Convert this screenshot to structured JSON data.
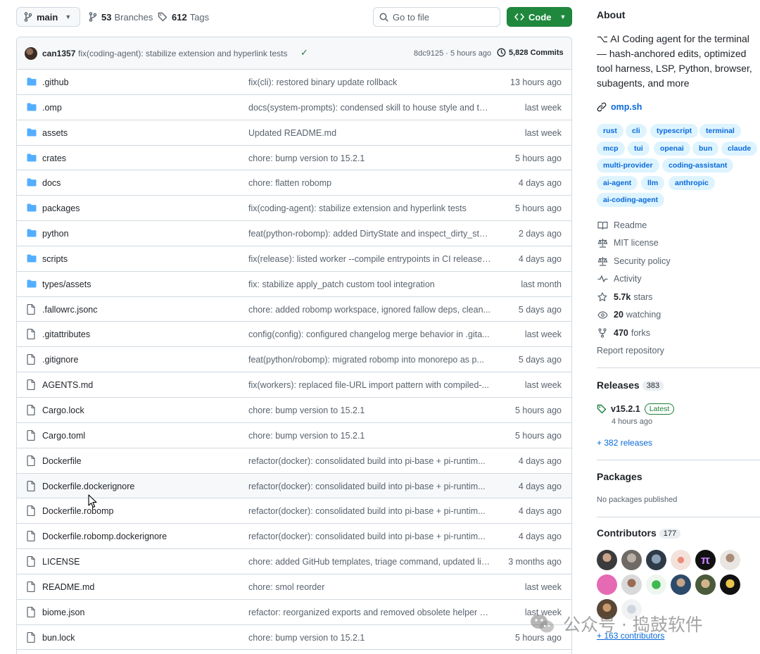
{
  "toolbar": {
    "branch": "main",
    "branches_count": "53",
    "branches_label": "Branches",
    "tags_count": "612",
    "tags_label": "Tags",
    "search_placeholder": "Go to file",
    "code_label": "Code"
  },
  "latest_commit": {
    "author": "can1357",
    "message": "fix(coding-agent): stabilize extension and hyperlink tests",
    "hash_time": "8dc9125 · 5 hours ago",
    "commits_count": "5,828 Commits"
  },
  "files": [
    {
      "name": ".github",
      "type": "folder",
      "message": "fix(cli): restored binary update rollback",
      "date": "13 hours ago"
    },
    {
      "name": ".omp",
      "type": "folder",
      "message": "docs(system-prompts): condensed skill to house style and to...",
      "date": "last week"
    },
    {
      "name": "assets",
      "type": "folder",
      "message": "Updated README.md",
      "date": "last week"
    },
    {
      "name": "crates",
      "type": "folder",
      "message": "chore: bump version to 15.2.1",
      "date": "5 hours ago"
    },
    {
      "name": "docs",
      "type": "folder",
      "message": "chore: flatten robomp",
      "date": "4 days ago"
    },
    {
      "name": "packages",
      "type": "folder",
      "message": "fix(coding-agent): stabilize extension and hyperlink tests",
      "date": "5 hours ago"
    },
    {
      "name": "python",
      "type": "folder",
      "message": "feat(python-robomp): added DirtyState and inspect_dirty_stat...",
      "date": "2 days ago"
    },
    {
      "name": "scripts",
      "type": "folder",
      "message": "fix(release): listed worker --compile entrypoints in CI release s...",
      "date": "4 days ago"
    },
    {
      "name": "types/assets",
      "type": "folder",
      "message": "fix: stabilize apply_patch custom tool integration",
      "date": "last month"
    },
    {
      "name": ".fallowrc.jsonc",
      "type": "file",
      "message": "chore: added robomp workspace, ignored fallow deps, clean...",
      "date": "5 days ago"
    },
    {
      "name": ".gitattributes",
      "type": "file",
      "message": "config(config): configured changelog merge behavior in .gita...",
      "date": "last week"
    },
    {
      "name": ".gitignore",
      "type": "file",
      "message": "feat(python/robomp): migrated robomp into monorepo as p...",
      "date": "5 days ago"
    },
    {
      "name": "AGENTS.md",
      "type": "file",
      "message": "fix(workers): replaced file-URL import pattern with compiled-...",
      "date": "last week"
    },
    {
      "name": "Cargo.lock",
      "type": "file",
      "message": "chore: bump version to 15.2.1",
      "date": "5 hours ago"
    },
    {
      "name": "Cargo.toml",
      "type": "file",
      "message": "chore: bump version to 15.2.1",
      "date": "5 hours ago"
    },
    {
      "name": "Dockerfile",
      "type": "file",
      "message": "refactor(docker): consolidated build into pi-base + pi-runtim...",
      "date": "4 days ago"
    },
    {
      "name": "Dockerfile.dockerignore",
      "type": "file",
      "message": "refactor(docker): consolidated build into pi-base + pi-runtim...",
      "date": "4 days ago"
    },
    {
      "name": "Dockerfile.robomp",
      "type": "file",
      "message": "refactor(docker): consolidated build into pi-base + pi-runtim...",
      "date": "4 days ago"
    },
    {
      "name": "Dockerfile.robomp.dockerignore",
      "type": "file",
      "message": "refactor(docker): consolidated build into pi-base + pi-runtim...",
      "date": "4 days ago"
    },
    {
      "name": "LICENSE",
      "type": "file",
      "message": "chore: added GitHub templates, triage command, updated lic...",
      "date": "3 months ago"
    },
    {
      "name": "README.md",
      "type": "file",
      "message": "chore: smol reorder",
      "date": "last week"
    },
    {
      "name": "biome.json",
      "type": "file",
      "message": "refactor: reorganized exports and removed obsolete helper b...",
      "date": "last week"
    },
    {
      "name": "bun.lock",
      "type": "file",
      "message": "chore: bump version to 15.2.1",
      "date": "5 hours ago"
    }
  ],
  "about": {
    "heading": "About",
    "description": "⌥ AI Coding agent for the terminal — hash-anchored edits, optimized tool harness, LSP, Python, browser, subagents, and more",
    "website": "omp.sh",
    "topics": [
      "rust",
      "cli",
      "typescript",
      "terminal",
      "mcp",
      "tui",
      "openai",
      "bun",
      "claude",
      "multi-provider",
      "coding-assistant",
      "ai-agent",
      "llm",
      "anthropic",
      "ai-coding-agent"
    ],
    "links": [
      {
        "icon": "book-icon",
        "label": "Readme"
      },
      {
        "icon": "scale-icon",
        "label": "MIT license"
      },
      {
        "icon": "scale-icon",
        "label": "Security policy"
      },
      {
        "icon": "pulse-icon",
        "label": "Activity"
      }
    ],
    "stars": {
      "count": "5.7k",
      "label": "stars"
    },
    "watching": {
      "count": "20",
      "label": "watching"
    },
    "forks": {
      "count": "470",
      "label": "forks"
    },
    "report": "Report repository"
  },
  "releases": {
    "heading": "Releases",
    "count": "383",
    "tag": "v15.2.1",
    "badge": "Latest",
    "date": "4 hours ago",
    "more": "+ 382 releases"
  },
  "packages": {
    "heading": "Packages",
    "text": "No packages published"
  },
  "contributors": {
    "heading": "Contributors",
    "count": "177",
    "more": "+ 163 contributors"
  },
  "watermark": "公众号 · 捣鼓软件",
  "colors": {
    "accent_link": "#0969da",
    "code_button": "#1f883d",
    "folder_icon": "#54aeff",
    "topic_bg": "#ddf4ff"
  }
}
